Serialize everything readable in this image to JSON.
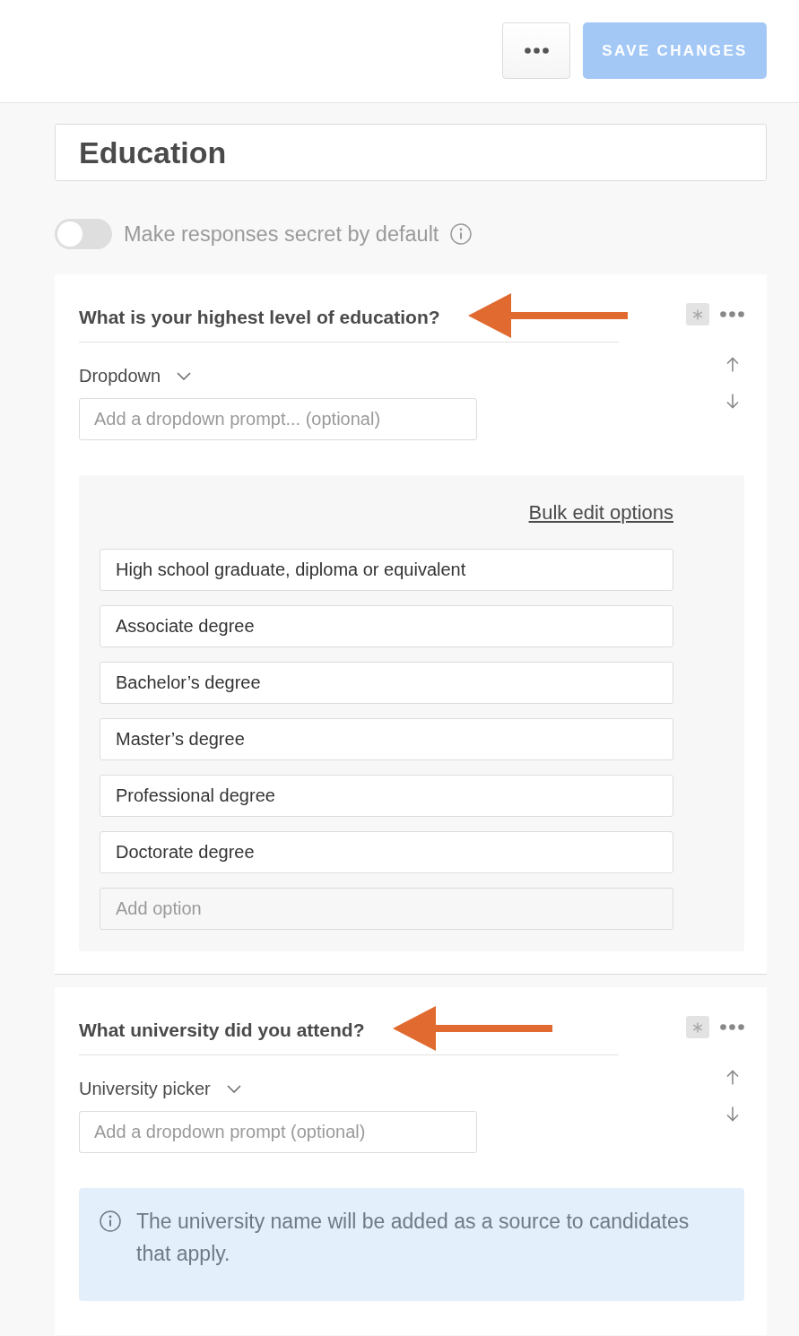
{
  "toolbar": {
    "save_button": {
      "label": "SAVE CHANGES",
      "disabled": true
    }
  },
  "section_title": {
    "value": "Education"
  },
  "secret_toggle": {
    "label": "Make responses secret by default",
    "on": false
  },
  "questions": [
    {
      "kind": "options",
      "title": "What is your highest level of education?",
      "arrow_marked": true,
      "type_label": "Dropdown",
      "prompt": {
        "placeholder": "Add a dropdown prompt... (optional)"
      },
      "bulk_edit_link": "Bulk edit options",
      "options": [
        "High school graduate, diploma or equivalent",
        "Associate degree",
        "Bachelor’s degree",
        "Master’s degree",
        "Professional degree",
        "Doctorate degree"
      ],
      "add_option": {
        "placeholder": "Add option"
      }
    },
    {
      "kind": "note",
      "title": "What university did you attend?",
      "arrow_marked": true,
      "type_label": "University picker",
      "prompt": {
        "placeholder": "Add a dropdown prompt (optional)"
      },
      "note": "The university name will be added as a source to candidates that apply."
    }
  ]
}
